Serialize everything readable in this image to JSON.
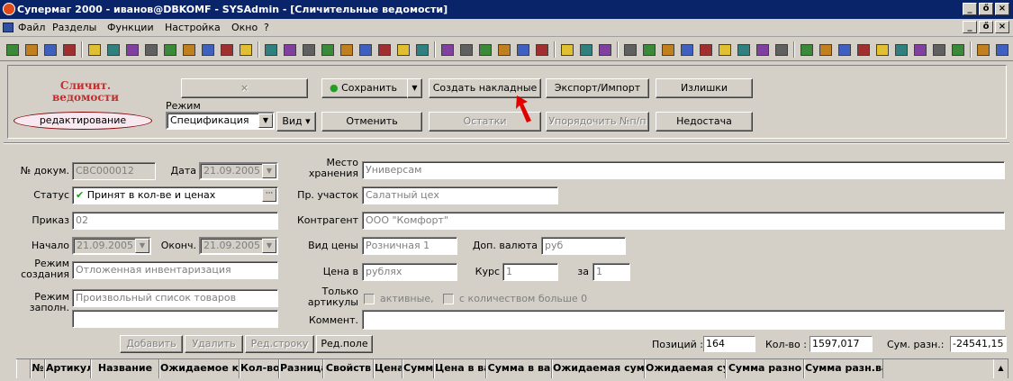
{
  "window": {
    "title": "Супермаг 2000 - иванов@DBKOMF - SYSAdmin - [Сличительные ведомости]"
  },
  "menu": [
    "Файл",
    "Разделы",
    "Функции",
    "Настройка",
    "Окно",
    "?"
  ],
  "title_controls": {
    "minimize": "_",
    "restore": "ő",
    "close": "×"
  },
  "module": {
    "title_line1": "Сличит.",
    "title_line2": "ведомости",
    "mode_badge": "редактирование"
  },
  "toolbar_main": {
    "clear": "×",
    "save": "Сохранить",
    "create_invoices": "Создать накладные",
    "export_import": "Экспорт/Импорт",
    "surplus": "Излишки",
    "mode_label": "Режим",
    "mode_value": "Спецификация",
    "view": "Вид",
    "cancel": "Отменить",
    "remains": "Остатки",
    "reorder": "Упорядочить №п/п",
    "shortage": "Недостача"
  },
  "form": {
    "doc_no_label": "№ докум.",
    "doc_no": "СВС000012",
    "date_label": "Дата",
    "date": "21.09.2005",
    "storage_label_1": "Место",
    "storage_label_2": "хранения",
    "storage": "Универсам",
    "status_label": "Статус",
    "status": "Принят в кол-ве и ценах",
    "section_label": "Пр. участок",
    "section": "Салатный цех",
    "order_label": "Приказ",
    "order": "02",
    "contractor_label": "Контрагент",
    "contractor": "ООО \"Комфорт\"",
    "start_label": "Начало",
    "start": "21.09.2005",
    "end_label": "Оконч.",
    "end": "21.09.2005",
    "price_type_label": "Вид цены",
    "price_type": "Розничная 1",
    "add_currency_label": "Доп. валюта",
    "add_currency": "руб",
    "creation_mode_label_1": "Режим",
    "creation_mode_label_2": "создания",
    "creation_mode": "Отложенная инвентаризация",
    "price_in_label": "Цена в",
    "price_in": "рублях",
    "rate_label": "Курс",
    "rate": "1",
    "per_label": "за",
    "per": "1",
    "fill_mode_label_1": "Режим",
    "fill_mode_label_2": "заполн.",
    "fill_mode": "Произвольный список товаров",
    "fill_mode_extra": "",
    "only_label_1": "Только",
    "only_label_2": "артикулы",
    "active_chk": "активные,",
    "qty_chk": "с количеством больше 0",
    "comment_label": "Коммент.",
    "comment": ""
  },
  "grid_toolbar": {
    "add": "Добавить",
    "delete": "Удалить",
    "edit_row": "Ред.строку",
    "edit_field": "Ред.поле"
  },
  "totals": {
    "positions_label": "Позиций :",
    "positions": "164",
    "qty_label": "Кол-во :",
    "qty": "1597,017",
    "diff_label": "Сум. разн.:",
    "diff": "-24541,15"
  },
  "grid_columns": [
    "№",
    "Артикул",
    "Название",
    "Ожидаемое ко",
    "Кол-во",
    "Разница",
    "Свойств",
    "Цена",
    "Сумма",
    "Цена в ва",
    "Сумма в ва",
    "Ожидаемая сум",
    "Ожидаемая сум",
    "Сумма разно",
    "Сумма разн.вал."
  ],
  "colors": {
    "title_bar": "#0a246a",
    "face": "#d4d0c8",
    "arrow": "#e00000",
    "module_title": "#c03030"
  }
}
